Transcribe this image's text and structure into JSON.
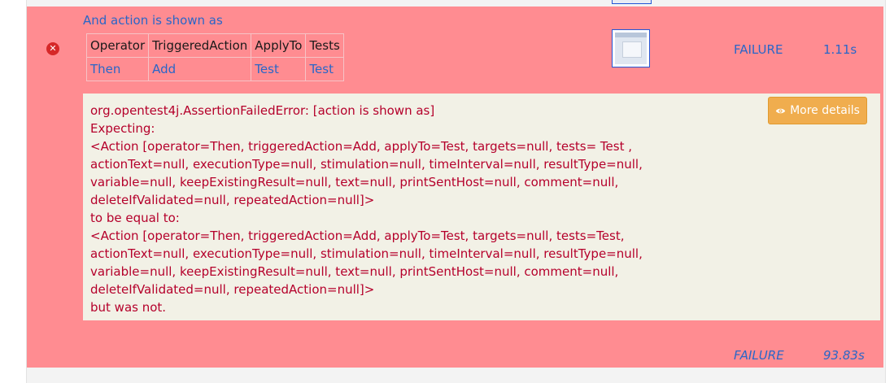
{
  "step": {
    "title": "And action is shown as",
    "fail_icon": "x-circle-icon",
    "table": {
      "headers": [
        "Operator",
        "TriggeredAction",
        "ApplyTo",
        "Tests"
      ],
      "rows": [
        [
          "Then",
          "Add",
          "Test",
          "Test"
        ]
      ]
    },
    "screenshot_icon": "screenshot-thumbnail",
    "status": "FAILURE",
    "duration": "1.11s"
  },
  "error": {
    "text": "org.opentest4j.AssertionFailedError: [action is shown as]\nExpecting:\n<Action [operator=Then, triggeredAction=Add, applyTo=Test, targets=null, tests= Test ,\nactionText=null, executionType=null, stimulation=null, timeInterval=null, resultType=null,\nvariable=null, keepExistingResult=null, text=null, printSentHost=null, comment=null,\ndeleteIfValidated=null, repeatedAction=null]>\nto be equal to:\n<Action [operator=Then, triggeredAction=Add, applyTo=Test, targets=null, tests=Test,\nactionText=null, executionType=null, stimulation=null, timeInterval=null, resultType=null,\nvariable=null, keepExistingResult=null, text=null, printSentHost=null, comment=null,\ndeleteIfValidated=null, repeatedAction=null]>\nbut was not.",
    "more_details_label": "More details",
    "more_details_icon": "eye-icon"
  },
  "scenario": {
    "status": "FAILURE",
    "duration": "93.83s"
  },
  "colors": {
    "failure_background": "#ff8c91",
    "error_text": "#b5002b",
    "link": "#2a66c8",
    "more_details_button": "#f0ad4e"
  }
}
